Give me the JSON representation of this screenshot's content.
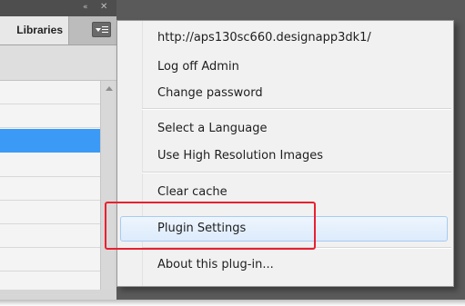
{
  "panel": {
    "tab_label": "Libraries",
    "collapse_glyph": "«",
    "close_glyph": "✕",
    "list_row_count": 9,
    "selected_row": 2,
    "colors": {
      "selected": "#3b9af5"
    }
  },
  "menu": {
    "items": [
      {
        "label": "http://aps130sc660.designapp3dk1/"
      },
      {
        "label": "Log off Admin"
      },
      {
        "label": "Change password"
      },
      {
        "label": "Select a Language"
      },
      {
        "label": "Use High Resolution Images"
      },
      {
        "label": "Clear cache"
      },
      {
        "label": "Plugin Settings"
      },
      {
        "label": "About this plug-in..."
      }
    ],
    "highlighted_item": "Plugin Settings"
  },
  "annotation": {
    "color": "#e8202f"
  }
}
